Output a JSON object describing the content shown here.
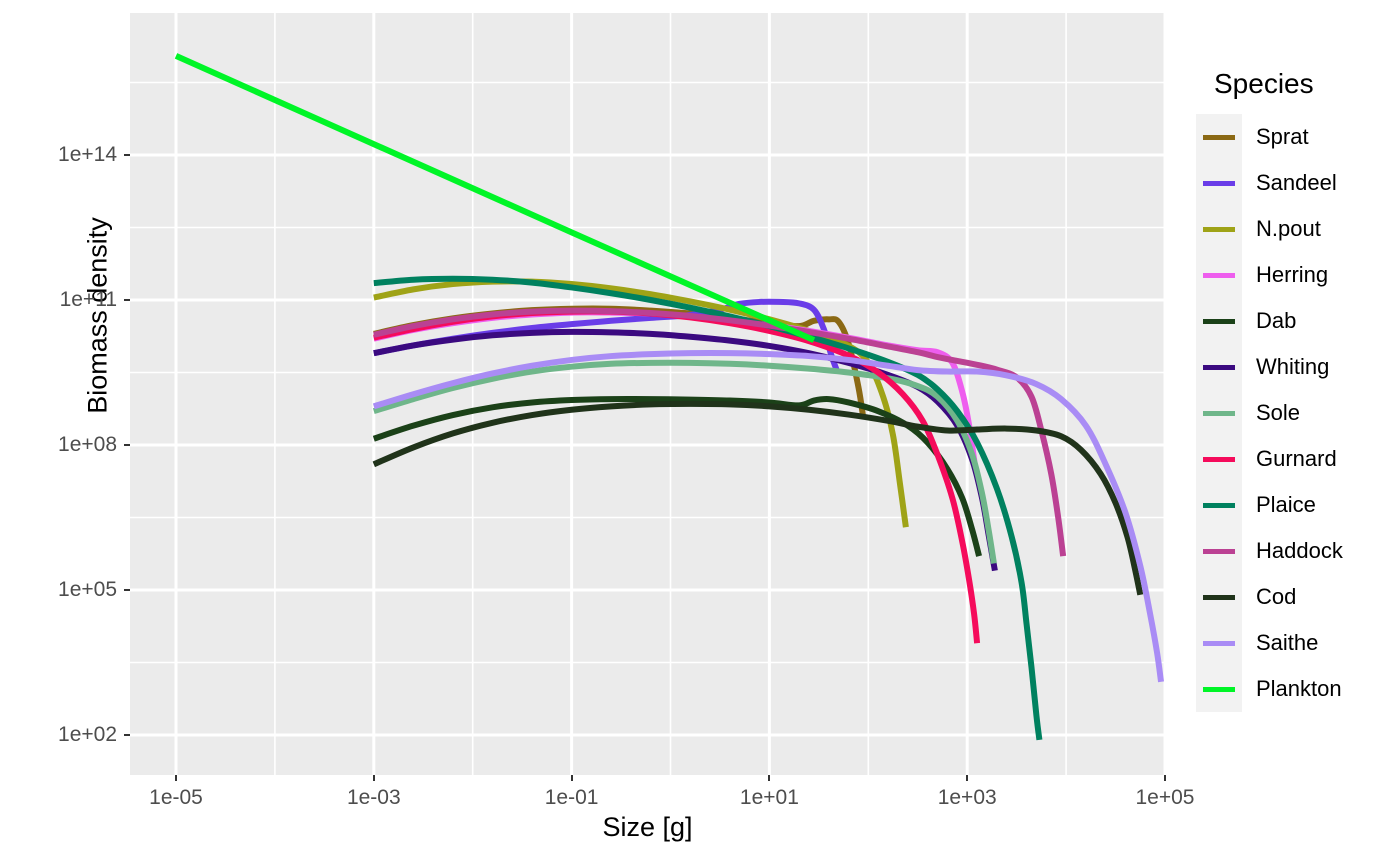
{
  "chart_data": {
    "type": "line",
    "title": "",
    "xlabel": "Size [g]",
    "ylabel": "Biomass density",
    "x_scale": "log10",
    "y_scale": "log10",
    "xlim": [
      1e-06,
      316000.0
    ],
    "ylim": [
      10.0,
      3160000000000000.0
    ],
    "x_ticks": [
      "1e-05",
      "1e-03",
      "1e-01",
      "1e+01",
      "1e+03",
      "1e+05"
    ],
    "x_tick_values": [
      -5,
      -3,
      -1,
      1,
      3,
      5
    ],
    "y_ticks": [
      "1e+02",
      "1e+05",
      "1e+08",
      "1e+11",
      "1e+14"
    ],
    "y_tick_values": [
      2,
      5,
      8,
      11,
      14
    ],
    "grid": true,
    "legend_position": "right",
    "legend_title": "Species",
    "panel_background": "#ebebeb",
    "gridline_color": "#ffffff",
    "series": [
      {
        "name": "Sprat",
        "color": "#8B6914",
        "points": [
          [
            -3,
            10.3
          ],
          [
            -2.6,
            10.48
          ],
          [
            -2.2,
            10.62
          ],
          [
            -1.8,
            10.72
          ],
          [
            -1.4,
            10.79
          ],
          [
            -1.0,
            10.82
          ],
          [
            -0.6,
            10.82
          ],
          [
            -0.2,
            10.78
          ],
          [
            0.2,
            10.72
          ],
          [
            0.6,
            10.63
          ],
          [
            1.0,
            10.52
          ],
          [
            1.3,
            10.46
          ],
          [
            1.45,
            10.57
          ],
          [
            1.6,
            10.6
          ],
          [
            1.7,
            10.55
          ],
          [
            1.8,
            10.1
          ],
          [
            1.9,
            9.2
          ],
          [
            1.95,
            8.55
          ]
        ]
      },
      {
        "name": "Sandeel",
        "color": "#6A3DE8",
        "points": [
          [
            -3,
            9.9
          ],
          [
            -2.6,
            10.06
          ],
          [
            -2.2,
            10.2
          ],
          [
            -1.8,
            10.32
          ],
          [
            -1.4,
            10.42
          ],
          [
            -1.0,
            10.5
          ],
          [
            -0.6,
            10.57
          ],
          [
            -0.2,
            10.63
          ],
          [
            0.2,
            10.69
          ],
          [
            0.5,
            10.8
          ],
          [
            0.7,
            10.92
          ],
          [
            0.9,
            10.96
          ],
          [
            1.1,
            10.96
          ],
          [
            1.3,
            10.93
          ],
          [
            1.45,
            10.8
          ],
          [
            1.55,
            10.4
          ],
          [
            1.62,
            9.9
          ],
          [
            1.68,
            9.55
          ]
        ]
      },
      {
        "name": "N.pout",
        "color": "#9FA317",
        "points": [
          [
            -3,
            11.05
          ],
          [
            -2.6,
            11.22
          ],
          [
            -2.2,
            11.33
          ],
          [
            -1.8,
            11.38
          ],
          [
            -1.4,
            11.38
          ],
          [
            -1.0,
            11.33
          ],
          [
            -0.6,
            11.24
          ],
          [
            -0.2,
            11.12
          ],
          [
            0.2,
            10.97
          ],
          [
            0.6,
            10.8
          ],
          [
            1.0,
            10.6
          ],
          [
            1.4,
            10.36
          ],
          [
            1.8,
            10.05
          ],
          [
            2.0,
            9.7
          ],
          [
            2.15,
            9.0
          ],
          [
            2.25,
            8.2
          ],
          [
            2.32,
            7.2
          ],
          [
            2.38,
            6.3
          ]
        ]
      },
      {
        "name": "Herring",
        "color": "#EE5EEE",
        "points": [
          [
            -3,
            10.2
          ],
          [
            -2.6,
            10.38
          ],
          [
            -2.2,
            10.52
          ],
          [
            -1.8,
            10.63
          ],
          [
            -1.4,
            10.7
          ],
          [
            -1.0,
            10.74
          ],
          [
            -0.6,
            10.74
          ],
          [
            -0.2,
            10.72
          ],
          [
            0.2,
            10.66
          ],
          [
            0.6,
            10.58
          ],
          [
            1.0,
            10.48
          ],
          [
            1.4,
            10.36
          ],
          [
            1.8,
            10.22
          ],
          [
            2.2,
            10.06
          ],
          [
            2.5,
            9.96
          ],
          [
            2.7,
            9.92
          ],
          [
            2.85,
            9.7
          ],
          [
            2.95,
            9.1
          ],
          [
            3.02,
            8.4
          ],
          [
            3.08,
            7.55
          ]
        ]
      },
      {
        "name": "Dab",
        "color": "#1B4118",
        "points": [
          [
            -3,
            8.13
          ],
          [
            -2.6,
            8.4
          ],
          [
            -2.2,
            8.62
          ],
          [
            -1.8,
            8.78
          ],
          [
            -1.4,
            8.88
          ],
          [
            -1.0,
            8.93
          ],
          [
            -0.6,
            8.95
          ],
          [
            -0.2,
            8.95
          ],
          [
            0.2,
            8.94
          ],
          [
            0.6,
            8.92
          ],
          [
            1.0,
            8.88
          ],
          [
            1.3,
            8.82
          ],
          [
            1.45,
            8.92
          ],
          [
            1.6,
            8.95
          ],
          [
            1.8,
            8.88
          ],
          [
            2.1,
            8.7
          ],
          [
            2.4,
            8.4
          ],
          [
            2.6,
            8.05
          ],
          [
            2.8,
            7.5
          ],
          [
            2.95,
            6.9
          ],
          [
            3.05,
            6.25
          ],
          [
            3.12,
            5.7
          ]
        ]
      },
      {
        "name": "Whiting",
        "color": "#3B0A80",
        "points": [
          [
            -3,
            9.9
          ],
          [
            -2.6,
            10.06
          ],
          [
            -2.2,
            10.18
          ],
          [
            -1.8,
            10.27
          ],
          [
            -1.4,
            10.32
          ],
          [
            -1.0,
            10.34
          ],
          [
            -0.6,
            10.33
          ],
          [
            -0.2,
            10.3
          ],
          [
            0.2,
            10.24
          ],
          [
            0.6,
            10.16
          ],
          [
            1.0,
            10.05
          ],
          [
            1.4,
            9.9
          ],
          [
            1.8,
            9.7
          ],
          [
            2.2,
            9.45
          ],
          [
            2.5,
            9.2
          ],
          [
            2.7,
            8.9
          ],
          [
            2.9,
            8.4
          ],
          [
            3.05,
            7.7
          ],
          [
            3.15,
            6.9
          ],
          [
            3.22,
            6.1
          ],
          [
            3.28,
            5.4
          ]
        ]
      },
      {
        "name": "Sole",
        "color": "#6FB68A",
        "points": [
          [
            -3,
            8.7
          ],
          [
            -2.6,
            8.95
          ],
          [
            -2.2,
            9.18
          ],
          [
            -1.8,
            9.37
          ],
          [
            -1.4,
            9.52
          ],
          [
            -1.0,
            9.62
          ],
          [
            -0.6,
            9.68
          ],
          [
            -0.2,
            9.7
          ],
          [
            0.2,
            9.7
          ],
          [
            0.6,
            9.68
          ],
          [
            1.0,
            9.64
          ],
          [
            1.4,
            9.58
          ],
          [
            1.8,
            9.5
          ],
          [
            2.2,
            9.38
          ],
          [
            2.5,
            9.22
          ],
          [
            2.7,
            9.0
          ],
          [
            2.9,
            8.5
          ],
          [
            3.05,
            7.8
          ],
          [
            3.15,
            7.0
          ],
          [
            3.22,
            6.2
          ],
          [
            3.27,
            5.55
          ]
        ]
      },
      {
        "name": "Gurnard",
        "color": "#F50B5B",
        "points": [
          [
            -3,
            10.22
          ],
          [
            -2.6,
            10.4
          ],
          [
            -2.2,
            10.55
          ],
          [
            -1.8,
            10.66
          ],
          [
            -1.4,
            10.73
          ],
          [
            -1.0,
            10.76
          ],
          [
            -0.6,
            10.76
          ],
          [
            -0.2,
            10.72
          ],
          [
            0.2,
            10.64
          ],
          [
            0.6,
            10.52
          ],
          [
            1.0,
            10.36
          ],
          [
            1.4,
            10.15
          ],
          [
            1.8,
            9.85
          ],
          [
            2.1,
            9.5
          ],
          [
            2.35,
            9.05
          ],
          [
            2.55,
            8.5
          ],
          [
            2.7,
            7.8
          ],
          [
            2.85,
            6.9
          ],
          [
            2.95,
            6.0
          ],
          [
            3.02,
            5.2
          ],
          [
            3.07,
            4.5
          ],
          [
            3.1,
            3.9
          ]
        ]
      },
      {
        "name": "Plaice",
        "color": "#00815F",
        "points": [
          [
            -3,
            11.35
          ],
          [
            -2.6,
            11.42
          ],
          [
            -2.2,
            11.44
          ],
          [
            -1.8,
            11.42
          ],
          [
            -1.4,
            11.36
          ],
          [
            -1.0,
            11.26
          ],
          [
            -0.6,
            11.14
          ],
          [
            -0.2,
            11.0
          ],
          [
            0.2,
            10.84
          ],
          [
            0.6,
            10.66
          ],
          [
            1.0,
            10.46
          ],
          [
            1.4,
            10.24
          ],
          [
            1.8,
            10.0
          ],
          [
            2.2,
            9.72
          ],
          [
            2.5,
            9.45
          ],
          [
            2.7,
            9.15
          ],
          [
            2.9,
            8.7
          ],
          [
            3.1,
            8.05
          ],
          [
            3.3,
            7.1
          ],
          [
            3.45,
            6.1
          ],
          [
            3.55,
            5.15
          ],
          [
            3.6,
            4.3
          ],
          [
            3.65,
            3.4
          ],
          [
            3.7,
            2.4
          ],
          [
            3.73,
            1.9
          ]
        ]
      },
      {
        "name": "Haddock",
        "color": "#BB4193",
        "points": [
          [
            -3,
            10.28
          ],
          [
            -2.6,
            10.46
          ],
          [
            -2.2,
            10.6
          ],
          [
            -1.8,
            10.7
          ],
          [
            -1.4,
            10.76
          ],
          [
            -1.0,
            10.78
          ],
          [
            -0.6,
            10.77
          ],
          [
            -0.2,
            10.73
          ],
          [
            0.2,
            10.67
          ],
          [
            0.6,
            10.58
          ],
          [
            1.0,
            10.47
          ],
          [
            1.4,
            10.34
          ],
          [
            1.8,
            10.2
          ],
          [
            2.2,
            10.04
          ],
          [
            2.5,
            9.92
          ],
          [
            2.7,
            9.82
          ],
          [
            2.9,
            9.74
          ],
          [
            3.1,
            9.66
          ],
          [
            3.3,
            9.56
          ],
          [
            3.5,
            9.4
          ],
          [
            3.65,
            9.0
          ],
          [
            3.75,
            8.3
          ],
          [
            3.85,
            7.4
          ],
          [
            3.92,
            6.5
          ],
          [
            3.97,
            5.7
          ]
        ]
      },
      {
        "name": "Cod",
        "color": "#20331A",
        "points": [
          [
            -3,
            7.6
          ],
          [
            -2.6,
            7.95
          ],
          [
            -2.2,
            8.24
          ],
          [
            -1.8,
            8.46
          ],
          [
            -1.4,
            8.62
          ],
          [
            -1.0,
            8.73
          ],
          [
            -0.6,
            8.8
          ],
          [
            -0.2,
            8.84
          ],
          [
            0.2,
            8.85
          ],
          [
            0.6,
            8.84
          ],
          [
            1.0,
            8.8
          ],
          [
            1.4,
            8.73
          ],
          [
            1.8,
            8.63
          ],
          [
            2.2,
            8.5
          ],
          [
            2.5,
            8.38
          ],
          [
            2.8,
            8.3
          ],
          [
            3.1,
            8.32
          ],
          [
            3.4,
            8.34
          ],
          [
            3.7,
            8.3
          ],
          [
            3.95,
            8.18
          ],
          [
            4.15,
            7.9
          ],
          [
            4.35,
            7.4
          ],
          [
            4.5,
            6.8
          ],
          [
            4.62,
            6.1
          ],
          [
            4.7,
            5.4
          ],
          [
            4.75,
            4.9
          ]
        ]
      },
      {
        "name": "Saithe",
        "color": "#A98CF5",
        "points": [
          [
            -3,
            8.8
          ],
          [
            -2.6,
            9.05
          ],
          [
            -2.2,
            9.28
          ],
          [
            -1.8,
            9.48
          ],
          [
            -1.4,
            9.64
          ],
          [
            -1.0,
            9.76
          ],
          [
            -0.6,
            9.84
          ],
          [
            -0.2,
            9.88
          ],
          [
            0.2,
            9.9
          ],
          [
            0.6,
            9.9
          ],
          [
            1.0,
            9.88
          ],
          [
            1.4,
            9.84
          ],
          [
            1.8,
            9.76
          ],
          [
            2.2,
            9.64
          ],
          [
            2.5,
            9.55
          ],
          [
            2.8,
            9.52
          ],
          [
            3.1,
            9.52
          ],
          [
            3.4,
            9.44
          ],
          [
            3.7,
            9.26
          ],
          [
            3.95,
            8.95
          ],
          [
            4.2,
            8.4
          ],
          [
            4.4,
            7.6
          ],
          [
            4.6,
            6.6
          ],
          [
            4.75,
            5.5
          ],
          [
            4.85,
            4.5
          ],
          [
            4.92,
            3.7
          ],
          [
            4.96,
            3.1
          ]
        ]
      },
      {
        "name": "Plankton",
        "color": "#00F527",
        "points": [
          [
            -5,
            16.05
          ],
          [
            -1.0,
            12.4
          ],
          [
            1.45,
            10.17
          ]
        ]
      }
    ]
  },
  "legend": {
    "title": "Species",
    "entries": [
      {
        "label": "Sprat",
        "color": "#8B6914"
      },
      {
        "label": "Sandeel",
        "color": "#6A3DE8"
      },
      {
        "label": "N.pout",
        "color": "#9FA317"
      },
      {
        "label": "Herring",
        "color": "#EE5EEE"
      },
      {
        "label": "Dab",
        "color": "#1B4118"
      },
      {
        "label": "Whiting",
        "color": "#3B0A80"
      },
      {
        "label": "Sole",
        "color": "#6FB68A"
      },
      {
        "label": "Gurnard",
        "color": "#F50B5B"
      },
      {
        "label": "Plaice",
        "color": "#00815F"
      },
      {
        "label": "Haddock",
        "color": "#BB4193"
      },
      {
        "label": "Cod",
        "color": "#20331A"
      },
      {
        "label": "Saithe",
        "color": "#A98CF5"
      },
      {
        "label": "Plankton",
        "color": "#00F527"
      }
    ]
  },
  "axes": {
    "x_title": "Size [g]",
    "y_title": "Biomass density"
  }
}
